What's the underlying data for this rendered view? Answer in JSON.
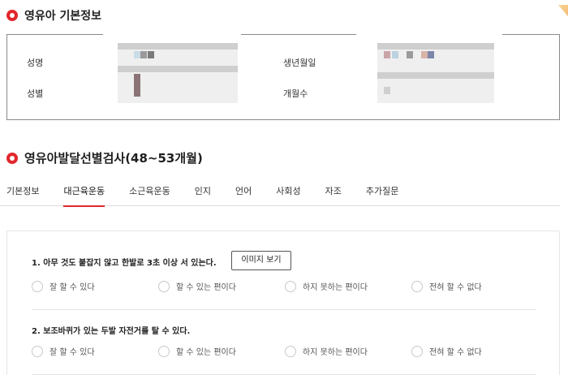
{
  "section1": {
    "title": "영유아 기본정보"
  },
  "info": {
    "labels": {
      "name": "성명",
      "gender": "성별",
      "birth": "생년월일",
      "months": "개월수"
    }
  },
  "section2": {
    "title": "영유아발달선별검사(48~53개월)"
  },
  "tabs": [
    {
      "label": "기본정보",
      "active": false
    },
    {
      "label": "대근육운동",
      "active": true
    },
    {
      "label": "소근육운동",
      "active": false
    },
    {
      "label": "인지",
      "active": false
    },
    {
      "label": "언어",
      "active": false
    },
    {
      "label": "사회성",
      "active": false
    },
    {
      "label": "자조",
      "active": false
    },
    {
      "label": "추가질문",
      "active": false
    }
  ],
  "questions": [
    {
      "text": "1. 아무 것도 붙잡지 않고 한발로 3초 이상 서 있는다.",
      "button": "이미지 보기",
      "options": [
        "잘 할 수 있다",
        "할 수 있는 편이다",
        "하지 못하는 편이다",
        "전혀 할 수 없다"
      ]
    },
    {
      "text": "2. 보조바퀴가 있는 두발 자전거를 탈 수 있다.",
      "options": [
        "잘 할 수 있다",
        "할 수 있는 편이다",
        "하지 못하는 편이다",
        "전혀 할 수 없다"
      ]
    }
  ],
  "colors": {
    "accent": "#e2262c",
    "border": "#8a8a8a",
    "muted_text": "#555555"
  },
  "icons": {
    "section_marker": "location-pin-icon"
  }
}
